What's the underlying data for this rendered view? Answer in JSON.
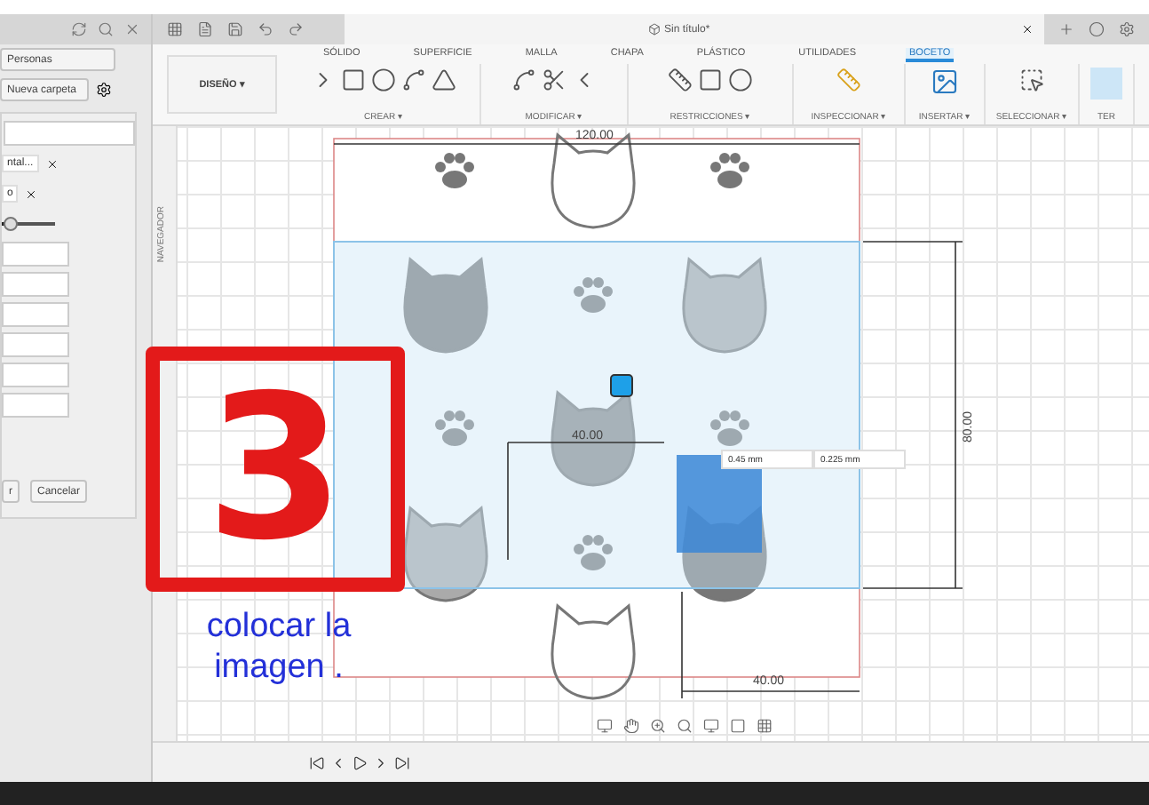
{
  "panel": {
    "buttons": [
      "Personas",
      "Nueva carpeta"
    ],
    "dialog": {
      "chips": [
        "ntal...",
        "o"
      ],
      "slider": {
        "level": 0.12
      },
      "buttons": [
        "r",
        "Cancelar"
      ]
    }
  },
  "document_tab": {
    "title": "Sin título*"
  },
  "ribbon": {
    "workspace": "DISEÑO ▾",
    "tabs": [
      {
        "label": "SÓLIDO",
        "selected": false
      },
      {
        "label": "SUPERFICIE",
        "selected": false
      },
      {
        "label": "MALLA",
        "selected": false
      },
      {
        "label": "CHAPA",
        "selected": false
      },
      {
        "label": "PLÁSTICO",
        "selected": false
      },
      {
        "label": "UTILIDADES",
        "selected": false
      },
      {
        "label": "BOCETO",
        "selected": true
      }
    ],
    "groups": [
      "CREAR ▾",
      "MODIFICAR ▾",
      "RESTRICCIONES ▾",
      "INSPECCIONAR ▾",
      "INSERTAR ▾",
      "SELECCIONAR ▾",
      "TER"
    ]
  },
  "browser": {
    "label": "NAVEGADOR"
  },
  "sketch": {
    "width_dimension": "120.00",
    "height_dimension": "80.00",
    "offset_dimension": "40.00",
    "bottom_dimension": "40.00",
    "inputs": [
      "0.45 mm",
      "0.225 mm"
    ]
  },
  "annotation": {
    "number": "3",
    "caption": "colocar la imagen ."
  }
}
